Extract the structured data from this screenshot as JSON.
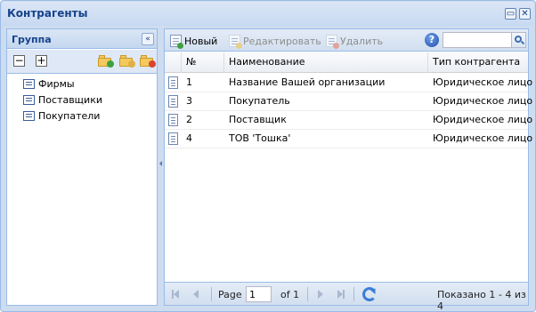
{
  "window": {
    "title": "Контрагенты",
    "tools": [
      "maximize-icon",
      "close-icon"
    ]
  },
  "west": {
    "title": "Группа",
    "collapse_icon": "double-chevron-left-icon",
    "toolbar": {
      "collapse_all": "−",
      "expand_all": "+",
      "add_folder_icon": "folder-add-icon",
      "edit_folder_icon": "folder-edit-icon",
      "delete_folder_icon": "folder-delete-icon"
    },
    "tree": [
      {
        "label": "Фирмы"
      },
      {
        "label": "Поставщики"
      },
      {
        "label": "Покупатели"
      }
    ]
  },
  "toolbar": {
    "new_label": "Новый",
    "edit_label": "Редактировать",
    "delete_label": "Удалить",
    "help_label": "?",
    "search_value": ""
  },
  "grid": {
    "columns": [
      "№",
      "Наименование",
      "Тип контрагента"
    ],
    "rows": [
      {
        "num": "1",
        "name": "Название Вашей организации",
        "type": "Юридическое лицо"
      },
      {
        "num": "3",
        "name": "Покупатель",
        "type": "Юридическое лицо"
      },
      {
        "num": "2",
        "name": "Поставщик",
        "type": "Юридическое лицо"
      },
      {
        "num": "4",
        "name": "ТОВ 'Тошка'",
        "type": "Юридическое лицо"
      }
    ]
  },
  "pager": {
    "page_label": "Page",
    "page_value": "1",
    "of_label": "of 1",
    "summary": "Показано 1 - 4 из 4"
  },
  "colors": {
    "header_text": "#15428b",
    "border": "#99bbe8",
    "background": "#cddcef"
  }
}
